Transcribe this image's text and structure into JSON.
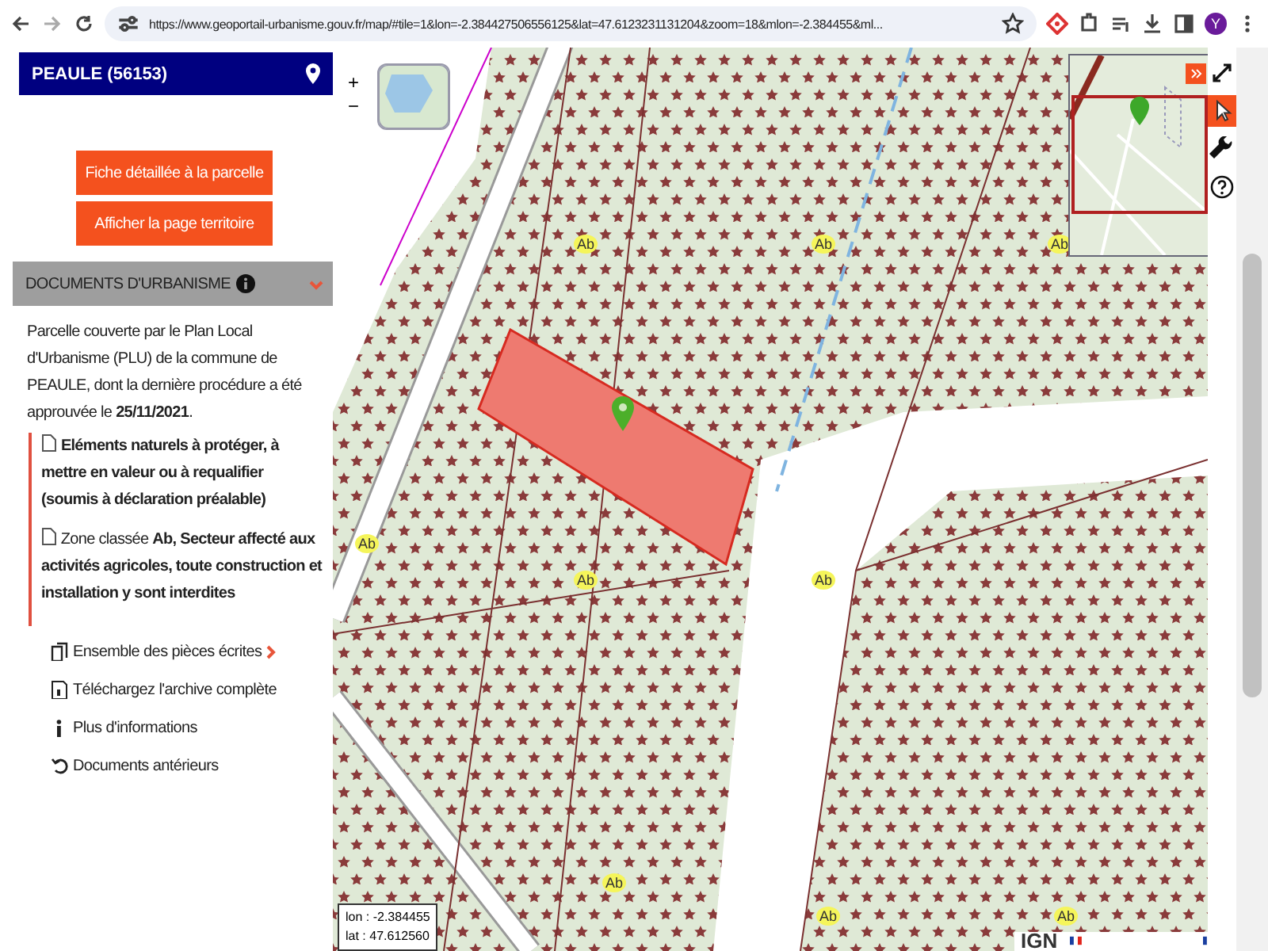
{
  "browser": {
    "url": "https://www.geoportail-urbanisme.gouv.fr/map/#tile=1&lon=-2.384427506556125&lat=47.6123231131204&zoom=18&mlon=-2.384455&ml...",
    "profile_initial": "Y"
  },
  "panel": {
    "title": "PEAULE (56153)",
    "buttons": [
      "Fiche détaillée à la parcelle",
      "Afficher la page territoire"
    ],
    "section": {
      "title": "DOCUMENTS D'URBANISME",
      "expanded": true
    },
    "summary": "Parcelle couverte par le Plan Local d'Urbanisme (PLU) de la commune de PEAULE, dont la dernière procédure a été approuvée le **25/11/2021**.",
    "prescriptions": [
      "**Eléments naturels à protéger, à mettre en valeur ou à requalifier (soumis à déclaration préalable)**",
      "Zone classée **Ab, Secteur affecté aux activités agricoles, toute construction et installation y sont interdites**"
    ],
    "links": [
      {
        "kind": "pieces",
        "label": "Ensemble des pièces écrites"
      },
      {
        "kind": "archive",
        "label": "Téléchargez l'archive complète"
      },
      {
        "kind": "info",
        "label": "Plus d'informations"
      },
      {
        "kind": "history",
        "label": "Documents antérieurs"
      }
    ]
  },
  "map": {
    "zoom_in": "+",
    "zoom_out": "−",
    "zone_labels": [
      "Ab",
      "Ab",
      "Ab",
      "Ab",
      "Ab",
      "Ab",
      "Ab",
      "Ab",
      "Ab"
    ],
    "coordinates": {
      "lon": "lon : -2.384455",
      "lat": "lat : 47.612560"
    },
    "attribution": "IGN",
    "tools": [
      {
        "kind": "fullscreen",
        "selected": false
      },
      {
        "kind": "pointer",
        "selected": true
      },
      {
        "kind": "wrench",
        "selected": false
      },
      {
        "kind": "help",
        "selected": false
      }
    ]
  }
}
